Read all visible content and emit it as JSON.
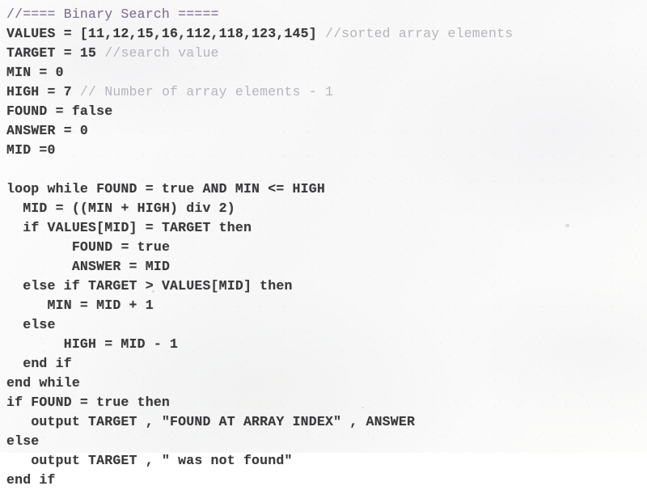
{
  "document": {
    "kind": "pseudocode-listing",
    "title_comment": "//==== Binary Search =====",
    "colors": {
      "code_text": "#3a3a3c",
      "inline_comment": "#b6b5bb",
      "header_comment": "#7d6f92",
      "page_background": "#fefefe"
    }
  },
  "code": {
    "lines": [
      {
        "indent": "",
        "code": "",
        "comment": "//==== Binary Search =====",
        "comment_style": "header"
      },
      {
        "indent": "",
        "code": "VALUES = [11,12,15,16,112,118,123,145] ",
        "comment": "//sorted array elements",
        "comment_style": "inline"
      },
      {
        "indent": "",
        "code": "TARGET = 15 ",
        "comment": "//search value",
        "comment_style": "inline"
      },
      {
        "indent": "",
        "code": "MIN = 0",
        "comment": "",
        "comment_style": "none"
      },
      {
        "indent": "",
        "code": "HIGH = 7 ",
        "comment": "// Number of array elements - 1",
        "comment_style": "inline"
      },
      {
        "indent": "",
        "code": "FOUND = false",
        "comment": "",
        "comment_style": "none"
      },
      {
        "indent": "",
        "code": "ANSWER = 0",
        "comment": "",
        "comment_style": "none"
      },
      {
        "indent": "",
        "code": "MID =0",
        "comment": "",
        "comment_style": "none"
      },
      {
        "indent": "",
        "code": "",
        "comment": "",
        "comment_style": "none"
      },
      {
        "indent": "",
        "code": "loop while FOUND = true AND MIN <= HIGH",
        "comment": "",
        "comment_style": "none"
      },
      {
        "indent": "  ",
        "code": "MID = ((MIN + HIGH) div 2)",
        "comment": "",
        "comment_style": "none"
      },
      {
        "indent": "  ",
        "code": "if VALUES[MID] = TARGET then",
        "comment": "",
        "comment_style": "none"
      },
      {
        "indent": "        ",
        "code": "FOUND = true",
        "comment": "",
        "comment_style": "none"
      },
      {
        "indent": "        ",
        "code": "ANSWER = MID",
        "comment": "",
        "comment_style": "none"
      },
      {
        "indent": "  ",
        "code": "else if TARGET > VALUES[MID] then",
        "comment": "",
        "comment_style": "none"
      },
      {
        "indent": "     ",
        "code": "MIN = MID + 1",
        "comment": "",
        "comment_style": "none"
      },
      {
        "indent": "  ",
        "code": "else",
        "comment": "",
        "comment_style": "none"
      },
      {
        "indent": "       ",
        "code": "HIGH = MID - 1",
        "comment": "",
        "comment_style": "none"
      },
      {
        "indent": "  ",
        "code": "end if",
        "comment": "",
        "comment_style": "none"
      },
      {
        "indent": "",
        "code": "end while",
        "comment": "",
        "comment_style": "none"
      },
      {
        "indent": "",
        "code": "if FOUND = true then",
        "comment": "",
        "comment_style": "none"
      },
      {
        "indent": "   ",
        "code": "output TARGET , \"FOUND AT ARRAY INDEX\" , ANSWER",
        "comment": "",
        "comment_style": "none"
      },
      {
        "indent": "",
        "code": "else",
        "comment": "",
        "comment_style": "none"
      },
      {
        "indent": "   ",
        "code": "output TARGET , \" was not found\"",
        "comment": "",
        "comment_style": "none"
      },
      {
        "indent": "",
        "code": "end if",
        "comment": "",
        "comment_style": "none"
      }
    ]
  }
}
